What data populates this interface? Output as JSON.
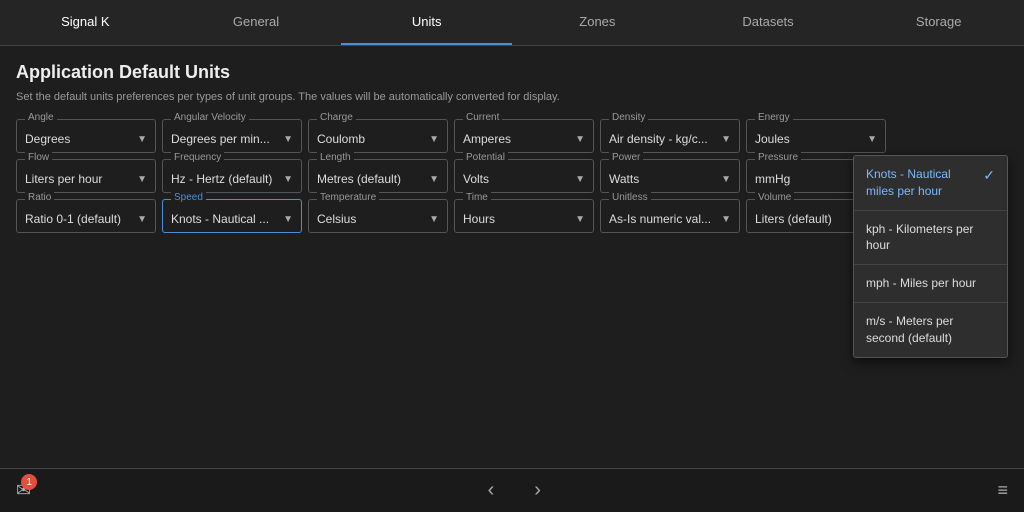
{
  "nav": {
    "items": [
      {
        "label": "Signal K",
        "active": false
      },
      {
        "label": "General",
        "active": false
      },
      {
        "label": "Units",
        "active": true
      },
      {
        "label": "Zones",
        "active": false
      },
      {
        "label": "Datasets",
        "active": false
      },
      {
        "label": "Storage",
        "active": false
      }
    ]
  },
  "page": {
    "title": "Application Default Units",
    "description": "Set the default units preferences per types of unit groups. The values will be automatically converted for display."
  },
  "unitGroups": [
    {
      "id": "angle",
      "label": "Angle",
      "value": "Degrees",
      "speedActive": false
    },
    {
      "id": "angular-velocity",
      "label": "Angular Velocity",
      "value": "Degrees per min...",
      "speedActive": false
    },
    {
      "id": "charge",
      "label": "Charge",
      "value": "Coulomb",
      "speedActive": false
    },
    {
      "id": "current",
      "label": "Current",
      "value": "Amperes",
      "speedActive": false
    },
    {
      "id": "density",
      "label": "Density",
      "value": "Air density - kg/c...",
      "speedActive": false
    },
    {
      "id": "energy",
      "label": "Energy",
      "value": "Joules",
      "speedActive": false
    },
    {
      "id": "flow",
      "label": "Flow",
      "value": "Liters per hour",
      "speedActive": false
    },
    {
      "id": "frequency",
      "label": "Frequency",
      "value": "Hz - Hertz (default)",
      "speedActive": false
    },
    {
      "id": "length",
      "label": "Length",
      "value": "Metres (default)",
      "speedActive": false
    },
    {
      "id": "potential",
      "label": "Potential",
      "value": "Volts",
      "speedActive": false
    },
    {
      "id": "power",
      "label": "Power",
      "value": "Watts",
      "speedActive": false
    },
    {
      "id": "pressure",
      "label": "Pressure",
      "value": "mmHg",
      "speedActive": false
    },
    {
      "id": "ratio",
      "label": "Ratio",
      "value": "Ratio 0-1 (default)",
      "speedActive": false
    },
    {
      "id": "speed",
      "label": "Speed",
      "value": "Knots - Nautical ...",
      "speedActive": true
    },
    {
      "id": "temperature",
      "label": "Temperature",
      "value": "Celsius",
      "speedActive": false
    },
    {
      "id": "time",
      "label": "Time",
      "value": "Hours",
      "speedActive": false
    },
    {
      "id": "unitless",
      "label": "Unitless",
      "value": "As-Is numeric val...",
      "speedActive": false
    },
    {
      "id": "volume",
      "label": "Volume",
      "value": "Liters (default)",
      "speedActive": false
    }
  ],
  "dropdown": {
    "items": [
      {
        "label": "Knots - Nautical miles per hour",
        "selected": true
      },
      {
        "label": "kph - Kilometers per hour",
        "selected": false
      },
      {
        "label": "mph - Miles per hour",
        "selected": false
      },
      {
        "label": "m/s - Meters per second (default)",
        "selected": false
      }
    ]
  },
  "bottomBar": {
    "emailBadge": "1",
    "prevArrow": "‹",
    "nextArrow": "›",
    "menuIcon": "≡"
  }
}
